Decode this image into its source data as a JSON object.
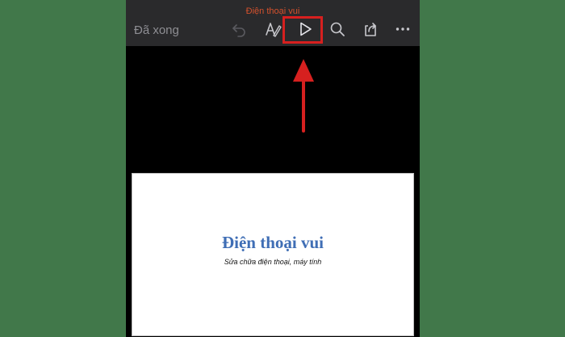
{
  "toolbar": {
    "document_title": "Điện thoại vui",
    "done_label": "Đã xong",
    "icons": [
      "undo-icon",
      "pen-icon",
      "play-icon",
      "search-icon",
      "share-icon",
      "more-icon"
    ]
  },
  "slide": {
    "title": "Điện thoại vui",
    "subtitle": "Sửa chữa điện thoại, máy tính"
  },
  "colors": {
    "background": "#41784a",
    "toolbar": "#2a2a2c",
    "title_orange": "#d4512d",
    "highlight_red": "#d6201f",
    "slide_title_blue": "#3f6eb5"
  }
}
